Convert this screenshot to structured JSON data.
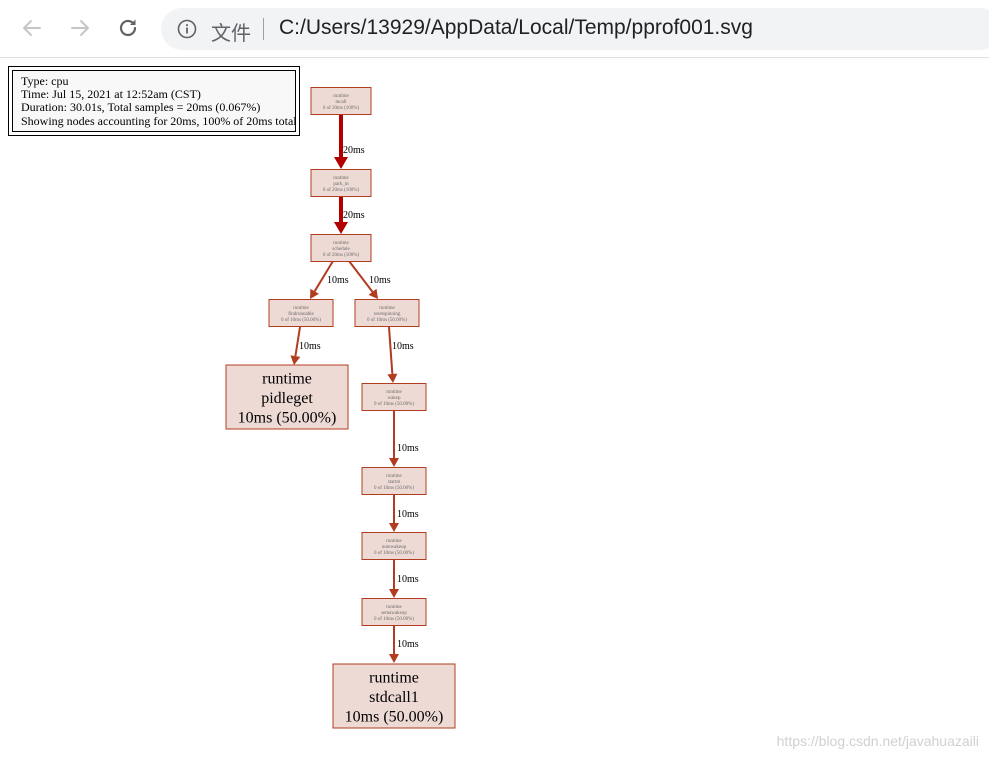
{
  "browser": {
    "file_label": "文件",
    "url": "C:/Users/13929/AppData/Local/Temp/pprof001.svg"
  },
  "legend": {
    "lines": [
      "Type: cpu",
      "Time: Jul 15, 2021 at 12:52am (CST)",
      "Duration: 30.01s, Total samples = 20ms (0.067%)",
      "Showing nodes accounting for 20ms, 100% of 20ms total"
    ]
  },
  "nodes": [
    {
      "id": "mcall",
      "lines": [
        "runtime",
        "mcall",
        "0 of 20ms (100%)"
      ],
      "size": "small"
    },
    {
      "id": "park_m",
      "lines": [
        "runtime",
        "park_m",
        "0 of 20ms (100%)"
      ],
      "size": "small"
    },
    {
      "id": "schedule",
      "lines": [
        "runtime",
        "schedule",
        "0 of 20ms (100%)"
      ],
      "size": "small"
    },
    {
      "id": "findrunnable",
      "lines": [
        "runtime",
        "findrunnable",
        "0 of 10ms (50.00%)"
      ],
      "size": "small"
    },
    {
      "id": "resetspinning",
      "lines": [
        "runtime",
        "resetspinning",
        "0 of 10ms (50.00%)"
      ],
      "size": "small"
    },
    {
      "id": "pidleget",
      "lines": [
        "runtime",
        "pidleget",
        "10ms (50.00%)"
      ],
      "size": "large"
    },
    {
      "id": "wakep",
      "lines": [
        "runtime",
        "wakep",
        "0 of 10ms (50.00%)"
      ],
      "size": "small"
    },
    {
      "id": "startm",
      "lines": [
        "runtime",
        "startm",
        "0 of 10ms (50.00%)"
      ],
      "size": "small"
    },
    {
      "id": "notewakeup",
      "lines": [
        "runtime",
        "notewakeup",
        "0 of 10ms (50.00%)"
      ],
      "size": "small"
    },
    {
      "id": "semawakeup",
      "lines": [
        "runtime",
        "semawakeup",
        "0 of 10ms (50.00%)"
      ],
      "size": "small"
    },
    {
      "id": "stdcall1",
      "lines": [
        "runtime",
        "stdcall1",
        "10ms (50.00%)"
      ],
      "size": "large"
    }
  ],
  "edges": [
    {
      "from": "mcall",
      "to": "park_m",
      "label": "20ms",
      "weight": "heavy"
    },
    {
      "from": "park_m",
      "to": "schedule",
      "label": "20ms",
      "weight": "heavy"
    },
    {
      "from": "schedule",
      "to": "findrunnable",
      "label": "10ms",
      "weight": "medium"
    },
    {
      "from": "schedule",
      "to": "resetspinning",
      "label": "10ms",
      "weight": "medium"
    },
    {
      "from": "findrunnable",
      "to": "pidleget",
      "label": "10ms",
      "weight": "medium"
    },
    {
      "from": "resetspinning",
      "to": "wakep",
      "label": "10ms",
      "weight": "medium"
    },
    {
      "from": "wakep",
      "to": "startm",
      "label": "10ms",
      "weight": "medium"
    },
    {
      "from": "startm",
      "to": "notewakeup",
      "label": "10ms",
      "weight": "medium"
    },
    {
      "from": "notewakeup",
      "to": "semawakeup",
      "label": "10ms",
      "weight": "medium"
    },
    {
      "from": "semawakeup",
      "to": "stdcall1",
      "label": "10ms",
      "weight": "medium"
    }
  ],
  "colors": {
    "node_fill": "#eddad5",
    "node_stroke": "#b23c1f",
    "heavy_edge": "#b20000",
    "medium_edge": "#b23c1f",
    "small_text": "#6b6b6b"
  },
  "watermark": "https://blog.csdn.net/javahuazaili"
}
